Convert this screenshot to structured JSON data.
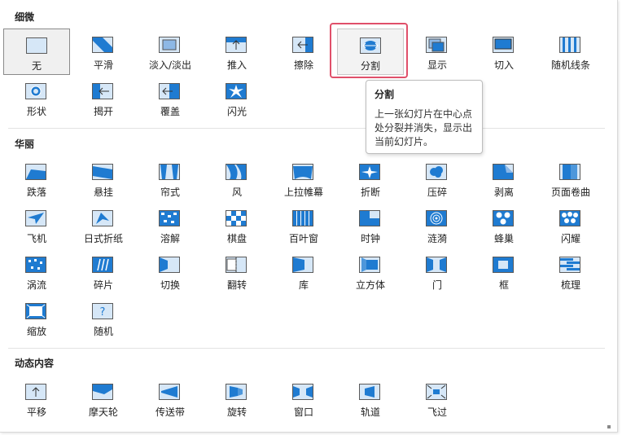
{
  "sections": [
    {
      "title": "细微",
      "items": [
        {
          "label": "无",
          "icon": "none-icon",
          "state": "selected"
        },
        {
          "label": "平滑",
          "icon": "smooth-icon"
        },
        {
          "label": "淡入/淡出",
          "icon": "fade-icon"
        },
        {
          "label": "推入",
          "icon": "push-icon"
        },
        {
          "label": "擦除",
          "icon": "wipe-icon"
        },
        {
          "label": "分割",
          "icon": "split-icon",
          "state": "hover"
        },
        {
          "label": "显示",
          "icon": "reveal-icon"
        },
        {
          "label": "切入",
          "icon": "cut-icon"
        },
        {
          "label": "随机线条",
          "icon": "random-bars-icon"
        },
        {
          "label": "形状",
          "icon": "shape-icon"
        },
        {
          "label": "揭开",
          "icon": "uncover-icon"
        },
        {
          "label": "覆盖",
          "icon": "cover-icon"
        },
        {
          "label": "闪光",
          "icon": "flash-icon"
        }
      ]
    },
    {
      "title": "华丽",
      "items": [
        {
          "label": "跌落",
          "icon": "fall-over-icon"
        },
        {
          "label": "悬挂",
          "icon": "drape-icon"
        },
        {
          "label": "帘式",
          "icon": "curtains-icon"
        },
        {
          "label": "风",
          "icon": "wind-icon"
        },
        {
          "label": "上拉帷幕",
          "icon": "prestige-icon"
        },
        {
          "label": "折断",
          "icon": "fracture-icon"
        },
        {
          "label": "压碎",
          "icon": "crush-icon"
        },
        {
          "label": "剥离",
          "icon": "peel-off-icon"
        },
        {
          "label": "页面卷曲",
          "icon": "page-curl-icon"
        },
        {
          "label": "飞机",
          "icon": "airplane-icon"
        },
        {
          "label": "日式折纸",
          "icon": "origami-icon"
        },
        {
          "label": "溶解",
          "icon": "dissolve-icon"
        },
        {
          "label": "棋盘",
          "icon": "checkerboard-icon"
        },
        {
          "label": "百叶窗",
          "icon": "blinds-icon"
        },
        {
          "label": "时钟",
          "icon": "clock-icon"
        },
        {
          "label": "涟漪",
          "icon": "ripple-icon"
        },
        {
          "label": "蜂巢",
          "icon": "honeycomb-icon"
        },
        {
          "label": "闪耀",
          "icon": "glitter-icon"
        },
        {
          "label": "涡流",
          "icon": "vortex-icon"
        },
        {
          "label": "碎片",
          "icon": "shred-icon"
        },
        {
          "label": "切换",
          "icon": "switch-icon"
        },
        {
          "label": "翻转",
          "icon": "flip-icon"
        },
        {
          "label": "库",
          "icon": "gallery-icon"
        },
        {
          "label": "立方体",
          "icon": "cube-icon"
        },
        {
          "label": "门",
          "icon": "doors-icon"
        },
        {
          "label": "框",
          "icon": "box-icon"
        },
        {
          "label": "梳理",
          "icon": "comb-icon"
        },
        {
          "label": "缩放",
          "icon": "zoom-icon"
        },
        {
          "label": "随机",
          "icon": "random-icon"
        }
      ]
    },
    {
      "title": "动态内容",
      "items": [
        {
          "label": "平移",
          "icon": "pan-icon"
        },
        {
          "label": "摩天轮",
          "icon": "ferris-wheel-icon"
        },
        {
          "label": "传送带",
          "icon": "conveyor-icon"
        },
        {
          "label": "旋转",
          "icon": "rotate-icon"
        },
        {
          "label": "窗口",
          "icon": "window-icon"
        },
        {
          "label": "轨道",
          "icon": "orbit-icon"
        },
        {
          "label": "飞过",
          "icon": "fly-through-icon"
        }
      ]
    }
  ],
  "tooltip": {
    "title": "分割",
    "body_lines": [
      "上一张幻灯片在中心点",
      "处分裂并消失，显示出",
      "当前幻灯片。"
    ]
  },
  "colors": {
    "accent_blue": "#1f7bd1",
    "light_blue": "#d6e7f7",
    "highlight": "#e0506a"
  }
}
